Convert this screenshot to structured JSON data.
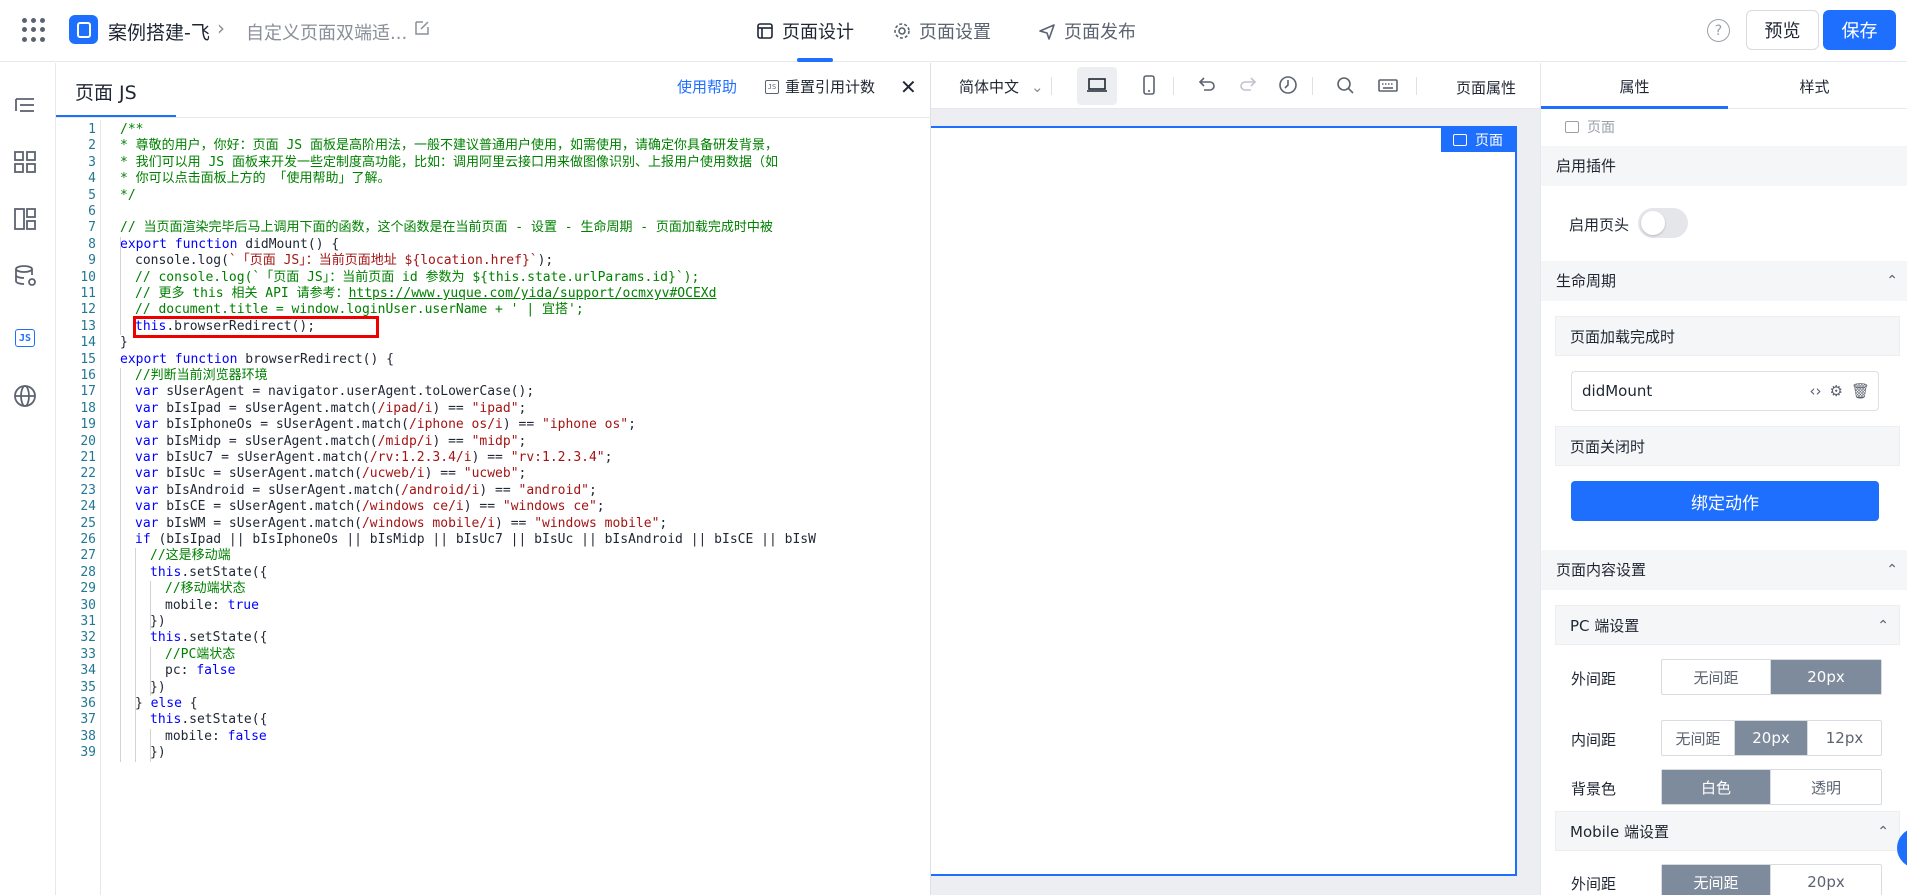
{
  "header": {
    "app_name": "案例搭建-飞",
    "crumb_separator": "›",
    "page_name": "自定义页面双端适...",
    "tabs": [
      {
        "label": "页面设计",
        "icon": "page-design-icon",
        "active": true
      },
      {
        "label": "页面设置",
        "icon": "gear-icon",
        "active": false
      },
      {
        "label": "页面发布",
        "icon": "send-icon",
        "active": false
      }
    ],
    "help_glyph": "?",
    "preview_label": "预览",
    "save_label": "保存",
    "accent_color": "#1f6fff"
  },
  "rail": {
    "items": [
      "outline-icon",
      "components-icon",
      "layout-icon",
      "data-source-icon",
      "js-icon",
      "globe-icon"
    ],
    "js_label": "JS"
  },
  "js_panel": {
    "title": "页面 JS",
    "help_link": "使用帮助",
    "reset_label": "重置引用计数",
    "reset_icon_text": "JS",
    "close_glyph": "✕",
    "code_lines": [
      {
        "n": "1",
        "text": "/**",
        "cls": "c-comment",
        "indent": 0
      },
      {
        "n": "2",
        "text": "* 尊敬的用户，你好：页面 JS 面板是高阶用法，一般不建议普通用户使用，如需使用，请确定你具备研发背景，",
        "cls": "c-comment",
        "indent": 0
      },
      {
        "n": "3",
        "text": "* 我们可以用 JS 面板来开发一些定制度高功能，比如：调用阿里云接口用来做图像识别、上报用户使用数据（如",
        "cls": "c-comment",
        "indent": 0
      },
      {
        "n": "4",
        "text": "* 你可以点击面板上方的 「使用帮助」了解。",
        "cls": "c-comment",
        "indent": 0
      },
      {
        "n": "5",
        "text": "*/",
        "cls": "c-comment",
        "indent": 0
      },
      {
        "n": "6",
        "text": "",
        "cls": "",
        "indent": 0
      },
      {
        "n": "7",
        "text": "// 当页面渲染完毕后马上调用下面的函数，这个函数是在当前页面 - 设置 - 生命周期 - 页面加载完成时中被",
        "cls": "c-comment",
        "indent": 0
      },
      {
        "n": "8",
        "text": "export function didMount() {",
        "cls": "mixed-kw",
        "indent": 0
      },
      {
        "n": "9",
        "text": "console.log(`「页面 JS」：当前页面地址 ${location.href}`);",
        "cls": "mixed-str",
        "indent": 1
      },
      {
        "n": "10",
        "text": "// console.log(`「页面 JS」：当前页面 id 参数为 ${this.state.urlParams.id}`);",
        "cls": "c-comment",
        "indent": 1
      },
      {
        "n": "11",
        "text": "// 更多 this 相关 API 请参考：https://www.yuque.com/yida/support/ocmxyv#OCEXd",
        "cls": "c-comment",
        "indent": 1
      },
      {
        "n": "12",
        "text": "// document.title = window.loginUser.userName + ' | 宜搭';",
        "cls": "c-comment",
        "indent": 1
      },
      {
        "n": "13",
        "text": "this.browserRedirect();",
        "cls": "mixed-this",
        "indent": 1
      },
      {
        "n": "14",
        "text": "}",
        "cls": "",
        "indent": 0
      },
      {
        "n": "15",
        "text": "export function browserRedirect() {",
        "cls": "mixed-kw",
        "indent": 0
      },
      {
        "n": "16",
        "text": "//判断当前浏览器环境",
        "cls": "c-comment",
        "indent": 1
      },
      {
        "n": "17",
        "text": "var sUserAgent = navigator.userAgent.toLowerCase();",
        "cls": "mixed-var",
        "indent": 1
      },
      {
        "n": "18",
        "text": "var bIsIpad = sUserAgent.match(/ipad/i) == \"ipad\";",
        "cls": "mixed-var",
        "indent": 1
      },
      {
        "n": "19",
        "text": "var bIsIphoneOs = sUserAgent.match(/iphone os/i) == \"iphone os\";",
        "cls": "mixed-var",
        "indent": 1
      },
      {
        "n": "20",
        "text": "var bIsMidp = sUserAgent.match(/midp/i) == \"midp\";",
        "cls": "mixed-var",
        "indent": 1
      },
      {
        "n": "21",
        "text": "var bIsUc7 = sUserAgent.match(/rv:1.2.3.4/i) == \"rv:1.2.3.4\";",
        "cls": "mixed-var",
        "indent": 1
      },
      {
        "n": "22",
        "text": "var bIsUc = sUserAgent.match(/ucweb/i) == \"ucweb\";",
        "cls": "mixed-var",
        "indent": 1
      },
      {
        "n": "23",
        "text": "var bIsAndroid = sUserAgent.match(/android/i) == \"android\";",
        "cls": "mixed-var",
        "indent": 1
      },
      {
        "n": "24",
        "text": "var bIsCE = sUserAgent.match(/windows ce/i) == \"windows ce\";",
        "cls": "mixed-var",
        "indent": 1
      },
      {
        "n": "25",
        "text": "var bIsWM = sUserAgent.match(/windows mobile/i) == \"windows mobile\";",
        "cls": "mixed-var",
        "indent": 1
      },
      {
        "n": "26",
        "text": "if (bIsIpad || bIsIphoneOs || bIsMidp || bIsUc7 || bIsUc || bIsAndroid || bIsCE || bIsW",
        "cls": "mixed-if",
        "indent": 1
      },
      {
        "n": "27",
        "text": "//这是移动端",
        "cls": "c-comment",
        "indent": 2
      },
      {
        "n": "28",
        "text": "this.setState({",
        "cls": "mixed-this",
        "indent": 2
      },
      {
        "n": "29",
        "text": "//移动端状态",
        "cls": "c-comment",
        "indent": 3
      },
      {
        "n": "30",
        "text": "mobile: true",
        "cls": "mixed-bool",
        "indent": 3
      },
      {
        "n": "31",
        "text": "})",
        "cls": "",
        "indent": 2
      },
      {
        "n": "32",
        "text": "this.setState({",
        "cls": "mixed-this",
        "indent": 2
      },
      {
        "n": "33",
        "text": "//PC端状态",
        "cls": "c-comment",
        "indent": 3
      },
      {
        "n": "34",
        "text": "pc: false",
        "cls": "mixed-bool",
        "indent": 3
      },
      {
        "n": "35",
        "text": "})",
        "cls": "",
        "indent": 2
      },
      {
        "n": "36",
        "text": "} else {",
        "cls": "mixed-else",
        "indent": 1
      },
      {
        "n": "37",
        "text": "this.setState({",
        "cls": "mixed-this",
        "indent": 2
      },
      {
        "n": "38",
        "text": "mobile: false",
        "cls": "mixed-bool",
        "indent": 3
      },
      {
        "n": "39",
        "text": "})",
        "cls": "",
        "indent": 2
      }
    ]
  },
  "canvas": {
    "language": "简体中文",
    "page_props_label": "页面属性",
    "page_badge": "页面",
    "toolbar_icons": [
      "pc-view-icon",
      "mobile-view-icon",
      "undo-icon",
      "redo-icon",
      "history-icon",
      "search-icon",
      "keyboard-icon"
    ]
  },
  "props_panel": {
    "tabs": [
      "属性",
      "样式"
    ],
    "crumb": "页面",
    "sections": {
      "plugins": "启用插件",
      "header_toggle_label": "启用页头",
      "lifecycle": "生命周期",
      "on_load": "页面加载完成时",
      "on_load_fn": "didMount",
      "on_close": "页面关闭时",
      "bind_action": "绑定动作",
      "content_settings": "页面内容设置",
      "pc_settings": "PC 端设置",
      "margin_label": "外间距",
      "padding_label": "内间距",
      "bg_label": "背景色",
      "mobile_settings": "Mobile 端设置"
    },
    "pc_margin_options": [
      "无间距",
      "20px"
    ],
    "pc_margin_selected": "20px",
    "pc_padding_options": [
      "无间距",
      "20px",
      "12px"
    ],
    "pc_padding_selected": "20px",
    "bg_options": [
      "白色",
      "透明"
    ],
    "bg_selected": "白色",
    "mobile_margin_options": [
      "无间距",
      "20px"
    ],
    "mobile_margin_selected": "无间距",
    "chevron_up": "⌃",
    "fn_icons": [
      "code-icon",
      "gear-icon",
      "trash-icon"
    ]
  }
}
